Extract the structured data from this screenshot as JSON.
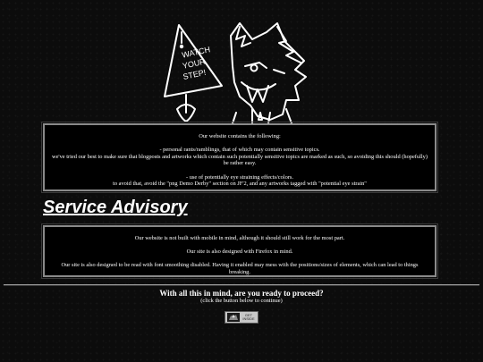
{
  "header_art": {
    "sign_text": [
      "WATCH",
      "YOUR",
      "STEP!"
    ]
  },
  "intro_box": {
    "lines": [
      "Our website contains the following:",
      "",
      "- personal rants/ramblings, that of which may contain sensitive topics.",
      "we've tried our best to make sure that blogposts and artworks which contain such potentially sensitive topics are marked as such, so avoiding this should (hopefully) be rather easy.",
      "",
      "- use of potentially eye straining effects/colors.",
      "to avoid that, avoid the \"png Demo Derby\" section on JF'2, and any artworks tagged with \"potential eye strain\""
    ]
  },
  "advisory": {
    "heading": "Service Advisory",
    "lines": [
      "Our website is not built with mobile in mind, although it should still work for the most part.",
      "",
      "Our site is also designed with Firefox in mind.",
      "",
      "Our site is also designed to be read with font smoothing disabled. Having it enabled may mess with the positions/sizes of elements, which can lead to things breaking."
    ]
  },
  "footer": {
    "question": "With all this in mind, are you ready to proceed?",
    "hint": "(click the button below to continue)",
    "enter_button": {
      "label": "GET INSIDE",
      "icon": "crest-icon"
    }
  }
}
